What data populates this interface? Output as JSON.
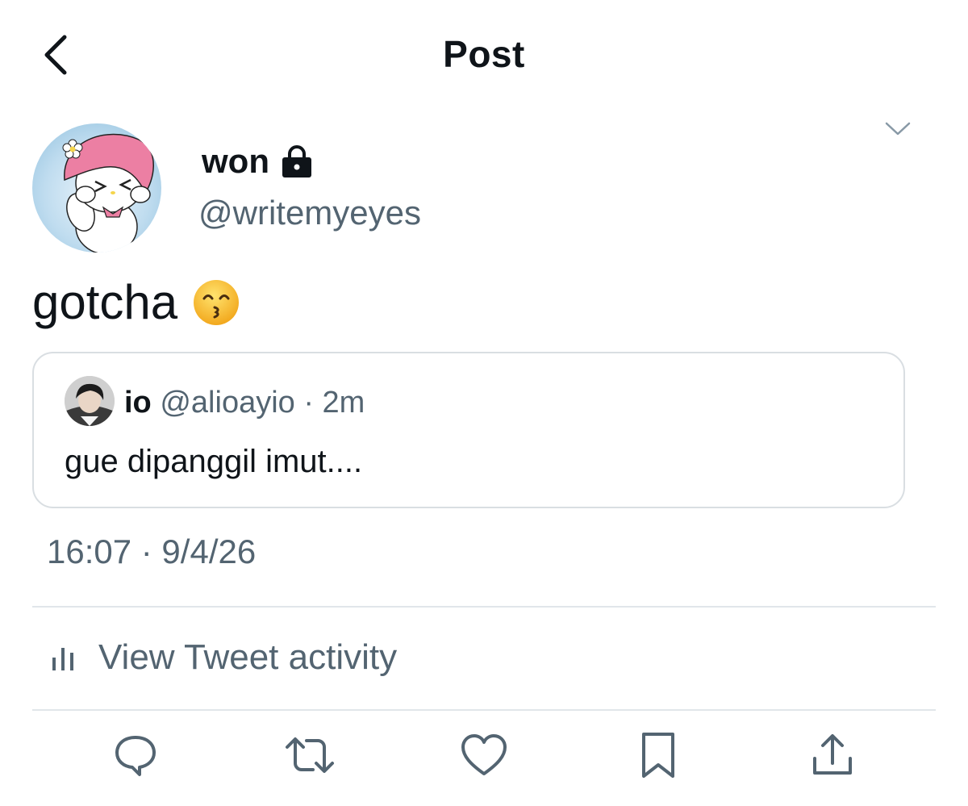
{
  "header": {
    "title": "Post",
    "back_icon": "chevron-left-icon"
  },
  "author": {
    "name": "won",
    "handle": "@writemyeyes",
    "lock_icon": "lock-icon",
    "menu_icon": "chevron-down-icon"
  },
  "tweet": {
    "text": "gotcha",
    "emoji": "kissing-face-with-smiling-eyes-emoji"
  },
  "quote": {
    "name": "io",
    "meta": "@alioayio · 2m",
    "text": "gue dipanggil imut...."
  },
  "timestamp": "16:07 · 9/4/26",
  "activity": {
    "label": "View Tweet activity",
    "icon": "bar-chart-icon"
  },
  "actions": [
    "reply-icon",
    "retweet-icon",
    "like-icon",
    "bookmark-icon",
    "share-icon"
  ],
  "colors": {
    "text": "#0f1419",
    "secondary": "#536471",
    "border": "#d9dee2"
  }
}
